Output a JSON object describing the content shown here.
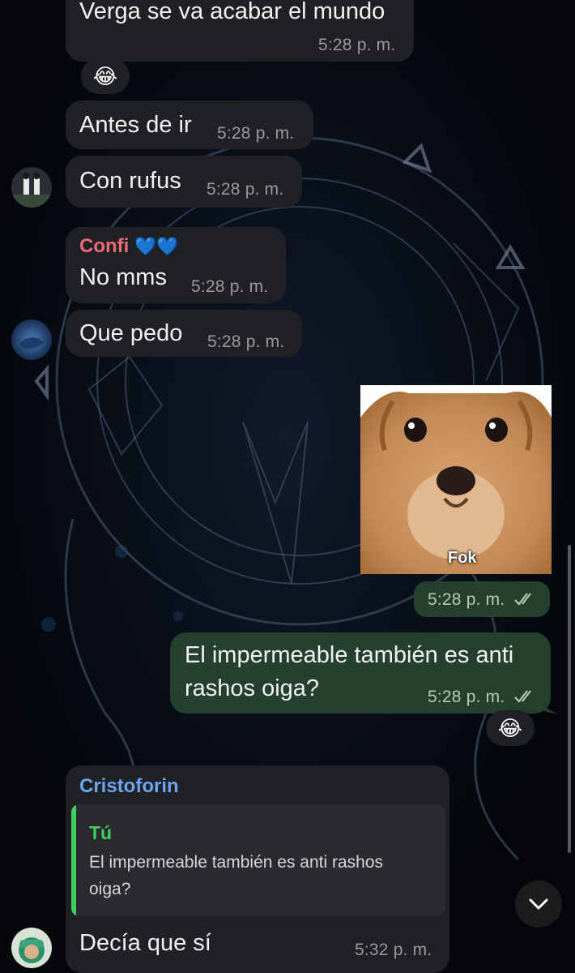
{
  "colors": {
    "incoming_bubble": "#202124",
    "outgoing_bubble": "#25402f",
    "confi_name": "#ef6b78",
    "cristoforin_name": "#6aa6f0",
    "reply_name": "#3fcf5f"
  },
  "messages": [
    {
      "text": "Verga se va acabar el mundo",
      "time": "5:28 p. m."
    },
    {
      "reaction": "😂"
    },
    {
      "text": "Antes de ir",
      "time": "5:28 p. m."
    },
    {
      "text": "Con rufus",
      "time": "5:28 p. m."
    },
    {
      "sender": "Confi",
      "sender_emoji": "💙💙",
      "text": "No mms",
      "time": "5:28 p. m."
    },
    {
      "text": "Que pedo",
      "time": "5:28 p. m."
    },
    {
      "sticker_caption": "Fok",
      "time": "5:28 p. m.",
      "status_icon": "double-check-icon"
    },
    {
      "text_line1": "El impermeable también es anti",
      "text_line2": "rashos oiga?",
      "time": "5:28 p. m.",
      "status_icon": "double-check-icon"
    },
    {
      "reaction": "😂"
    },
    {
      "sender": "Cristoforin",
      "reply_to": {
        "name": "Tú",
        "text_line1": "El impermeable también es anti rashos",
        "text_line2": "oiga?"
      },
      "text": "Decía que sí",
      "time": "5:32 p. m."
    }
  ]
}
